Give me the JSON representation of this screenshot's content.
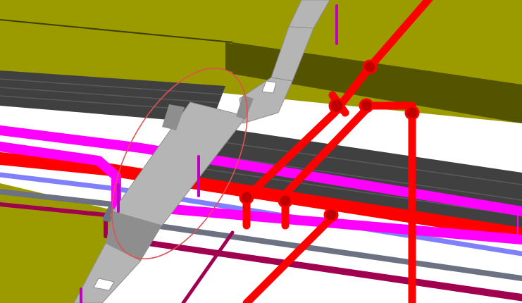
{
  "viewport": {
    "background": "#ffffff",
    "colors": {
      "slab_top": "#9b9b00",
      "slab_side": "#545400",
      "slab_dark": "#3f3f00",
      "cable_tray": "#404040",
      "cable_tray_light": "#5a5a5a",
      "duct": "#b5b5b5",
      "duct_shade": "#8e8e8e",
      "fire_pipe": "#ff0000",
      "fire_pipe_shade": "#c00000",
      "magenta_pipe": "#ff00ff",
      "magenta_shade": "#c000c0",
      "steel_pipe": "#6d7283",
      "purple_pipe": "#8080ff",
      "crimson_pipe": "#a0004f",
      "clash_marker": "#e05050"
    },
    "annotations": {
      "clash_marker": "ellipse"
    }
  }
}
